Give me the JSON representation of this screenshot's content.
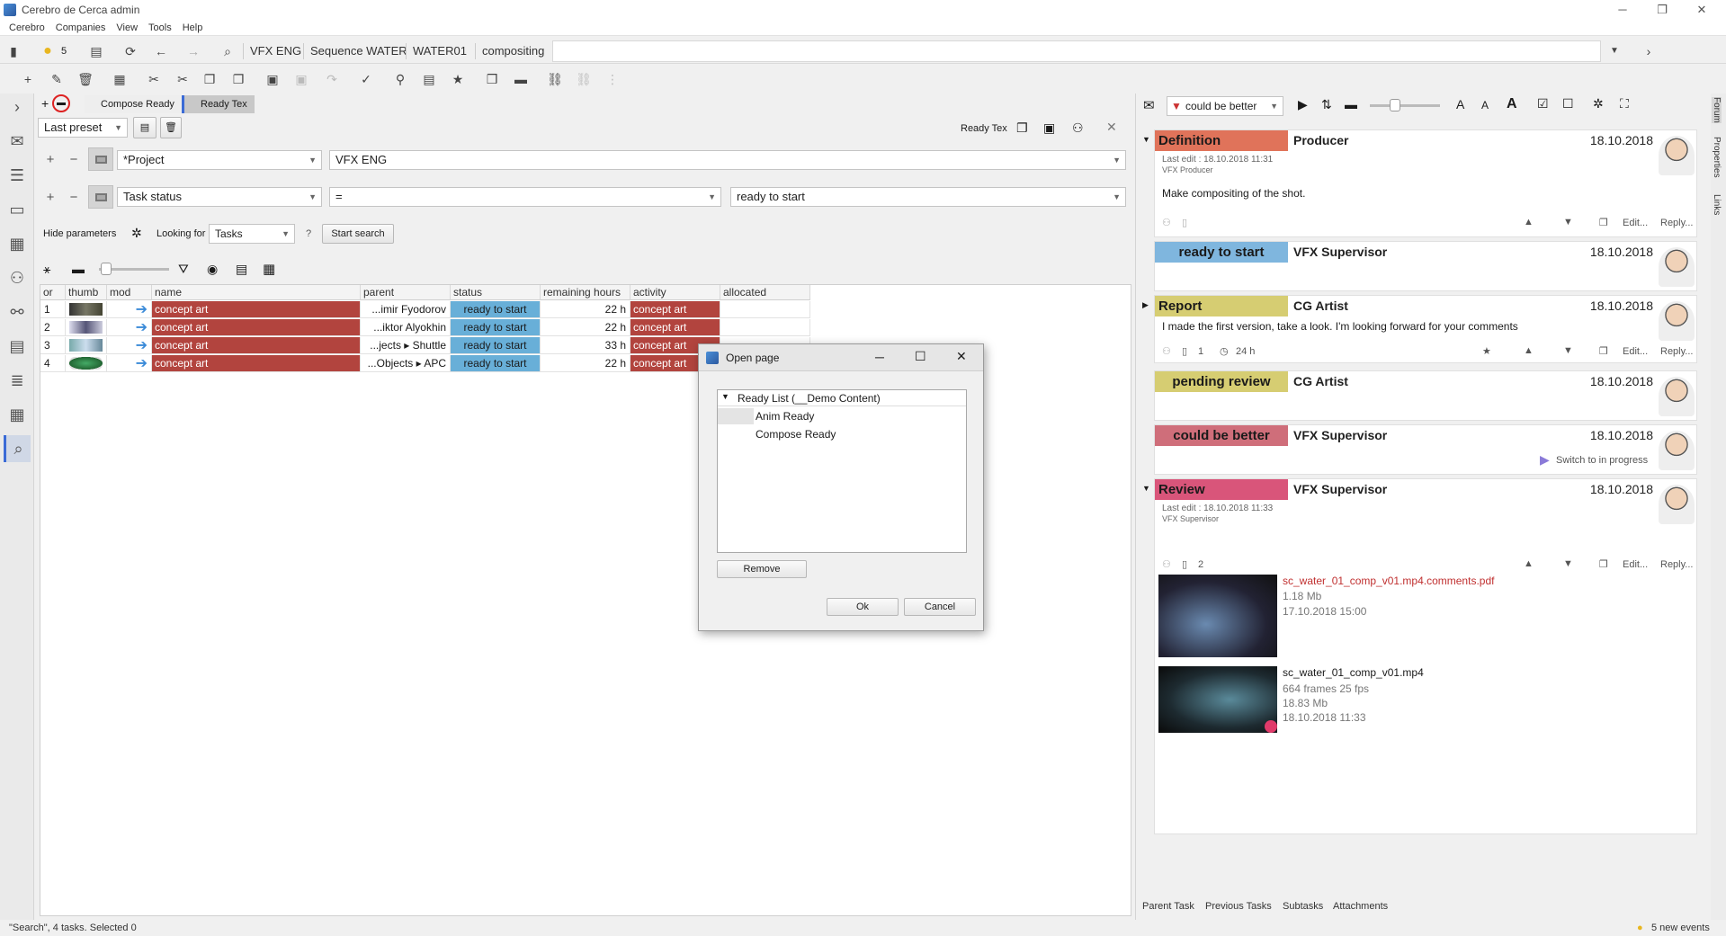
{
  "window": {
    "title": "Cerebro de Cerca  admin",
    "min": "─",
    "max": "❐",
    "close": "✕"
  },
  "menu": [
    "Cerebro",
    "Companies",
    "View",
    "Tools",
    "Help"
  ],
  "nav": {
    "count": "5",
    "crumbs": [
      "VFX ENG",
      "Sequence WATER",
      "WATER01",
      "compositing"
    ]
  },
  "tabs": {
    "add": "+",
    "t1": "Compose Ready",
    "t2": "Ready Tex"
  },
  "search": {
    "preset": "Last preset",
    "pane_title": "Ready Tex",
    "row1": {
      "field": "*Project",
      "value": "VFX ENG"
    },
    "row2": {
      "field": "Task status",
      "op": "=",
      "value": "ready to start"
    },
    "hide_params": "Hide parameters",
    "looking_for": "Looking for",
    "looking_value": "Tasks",
    "help": "?",
    "start": "Start search"
  },
  "table": {
    "headers": [
      "or",
      "thumb",
      "mod",
      "name",
      "parent",
      "status",
      "remaining hours",
      "activity",
      "allocated"
    ],
    "rows": [
      {
        "or": "1",
        "name": "concept art",
        "parent": "...imir Fyodorov",
        "status": "ready to start",
        "hours": "22 h",
        "activity": "concept art"
      },
      {
        "or": "2",
        "name": "concept art",
        "parent": "...iktor Alyokhin",
        "status": "ready to start",
        "hours": "22 h",
        "activity": "concept art"
      },
      {
        "or": "3",
        "name": "concept art",
        "parent": "...jects ▸ Shuttle",
        "status": "ready to start",
        "hours": "33 h",
        "activity": "concept art"
      },
      {
        "or": "4",
        "name": "concept art",
        "parent": "...Objects ▸ APC",
        "status": "ready to start",
        "hours": "22 h",
        "activity": "concept art"
      }
    ]
  },
  "dialog": {
    "title": "Open page",
    "tree_root": "Ready List (__Demo Content)",
    "items": [
      "Anim Ready",
      "Compose Ready"
    ],
    "remove": "Remove",
    "ok": "Ok",
    "cancel": "Cancel"
  },
  "status": {
    "text": "\"Search\", 4 tasks. Selected 0",
    "events": "5 new events"
  },
  "forum": {
    "status_select": "could be better",
    "cards": [
      {
        "status": "Definition",
        "who": "Producer",
        "date": "18.10.2018",
        "meta1": "Last edit : 18.10.2018 11:31",
        "meta2": "VFX Producer",
        "body": "Make compositing of the shot.",
        "edit": "Edit...",
        "reply": "Reply...",
        "color": "#e0735a"
      },
      {
        "status": "ready to start",
        "who": "VFX Supervisor",
        "date": "18.10.2018",
        "color": "#7fb6de"
      },
      {
        "status": "Report",
        "who": "CG Artist",
        "date": "18.10.2018",
        "body": "I made the first version, take a look. I'm looking forward for your comments",
        "files": "1",
        "hours": "24 h",
        "edit": "Edit...",
        "reply": "Reply...",
        "color": "#d6cd72"
      },
      {
        "status": "pending review",
        "who": "CG Artist",
        "date": "18.10.2018",
        "color": "#d6cd72"
      },
      {
        "status": "could be better",
        "who": "VFX Supervisor",
        "date": "18.10.2018",
        "note": "Switch to in progress",
        "color": "#cf6e7a"
      },
      {
        "status": "Review",
        "who": "VFX Supervisor",
        "date": "18.10.2018",
        "meta1": "Last edit : 18.10.2018 11:33",
        "meta2": "VFX Supervisor",
        "files": "2",
        "edit": "Edit...",
        "reply": "Reply...",
        "color": "#d9557a"
      }
    ],
    "attachments": [
      {
        "name": "sc_water_01_comp_v01.mp4.comments.pdf",
        "l1": "1.18 Mb",
        "l2": "17.10.2018 15:00"
      },
      {
        "name": "sc_water_01_comp_v01.mp4",
        "l1": "664 frames 25 fps",
        "l2": "18.83 Mb",
        "l3": "18.10.2018 11:33"
      }
    ],
    "bottom_tabs": [
      "Parent Task",
      "Previous Tasks",
      "Subtasks",
      "Attachments"
    ],
    "side_tabs": [
      "Forum",
      "Properties",
      "Links"
    ]
  }
}
